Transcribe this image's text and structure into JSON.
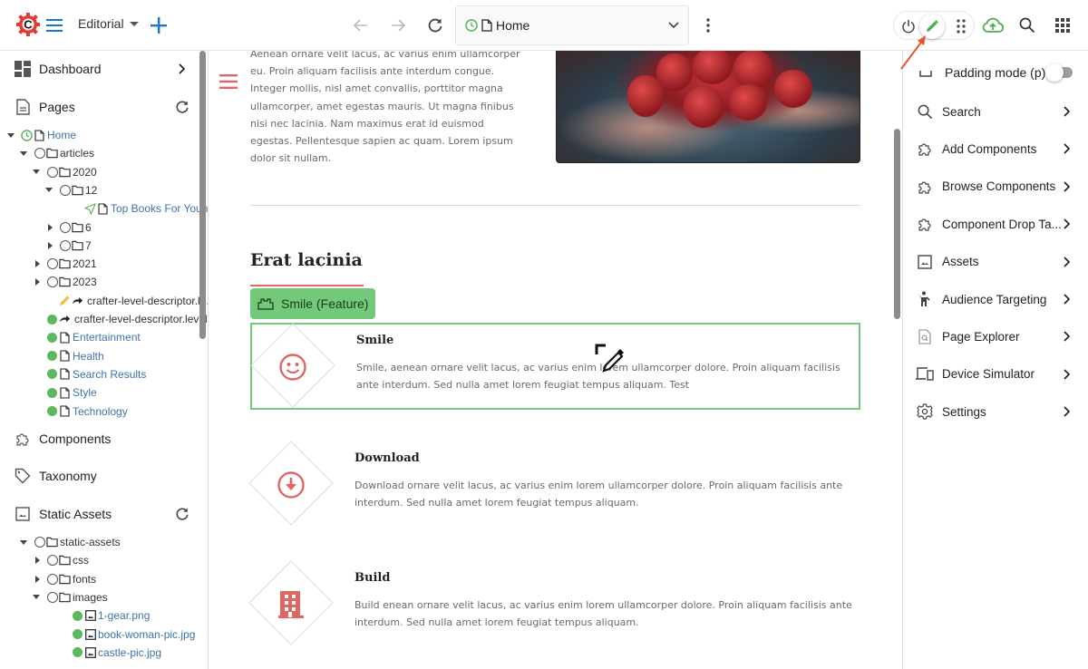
{
  "topbar": {
    "site_name": "Editorial",
    "address": {
      "page": "Home"
    },
    "colors": {
      "brand_red": "#e53935",
      "accent_blue": "#1976d2",
      "green": "#4caf50"
    }
  },
  "left_sidebar": {
    "sections": {
      "dashboard": "Dashboard",
      "pages": "Pages",
      "components": "Components",
      "taxonomy": "Taxonomy",
      "static_assets": "Static Assets"
    },
    "pages_tree": [
      {
        "label": "Home",
        "status": "scheduled",
        "icon": "page",
        "expand": "open"
      },
      {
        "label": "articles",
        "status": "none",
        "icon": "folder",
        "expand": "open"
      },
      {
        "label": "2020",
        "status": "none",
        "icon": "folder",
        "expand": "open"
      },
      {
        "label": "12",
        "status": "none",
        "icon": "folder",
        "expand": "open"
      },
      {
        "label": "Top Books For Youn...",
        "status": "submitted",
        "icon": "page",
        "expand": ""
      },
      {
        "label": "6",
        "status": "none",
        "icon": "folder",
        "expand": "closed"
      },
      {
        "label": "7",
        "status": "none",
        "icon": "folder",
        "expand": "closed"
      },
      {
        "label": "2021",
        "status": "none",
        "icon": "folder",
        "expand": "closed"
      },
      {
        "label": "2023",
        "status": "none",
        "icon": "folder",
        "expand": "closed"
      },
      {
        "label": "crafter-level-descriptor.le...",
        "status": "edited",
        "icon": "level-descriptor",
        "expand": ""
      },
      {
        "label": "crafter-level-descriptor.level...",
        "status": "live",
        "icon": "level-descriptor",
        "expand": ""
      },
      {
        "label": "Entertainment",
        "status": "live",
        "icon": "page",
        "expand": ""
      },
      {
        "label": "Health",
        "status": "live",
        "icon": "page",
        "expand": ""
      },
      {
        "label": "Search Results",
        "status": "live",
        "icon": "page",
        "expand": ""
      },
      {
        "label": "Style",
        "status": "live",
        "icon": "page",
        "expand": ""
      },
      {
        "label": "Technology",
        "status": "live",
        "icon": "page",
        "expand": ""
      }
    ],
    "assets_tree": [
      {
        "label": "static-assets",
        "status": "none",
        "icon": "folder",
        "expand": "open"
      },
      {
        "label": "css",
        "status": "none",
        "icon": "folder",
        "expand": "closed"
      },
      {
        "label": "fonts",
        "status": "none",
        "icon": "folder",
        "expand": "closed"
      },
      {
        "label": "images",
        "status": "none",
        "icon": "folder",
        "expand": "open"
      },
      {
        "label": "1-gear.png",
        "status": "live",
        "icon": "image",
        "expand": ""
      },
      {
        "label": "book-woman-pic.jpg",
        "status": "live",
        "icon": "image",
        "expand": ""
      },
      {
        "label": "castle-pic.jpg",
        "status": "live",
        "icon": "image",
        "expand": ""
      }
    ]
  },
  "preview": {
    "intro_paragraph": "Aenean ornare velit lacus, ac varius enim ullamcorper eu. Proin aliquam facilisis ante interdum congue. Integer mollis, nisl amet convallis, porttitor magna ullamcorper, amet egestas mauris. Ut magna finibus nisi nec lacinia. Nam maximus erat id euismod egestas. Pellentesque sapien ac quam. Lorem ipsum dolor sit nullam.",
    "image_alt": "strawberries in hands",
    "section_heading": "Erat lacinia",
    "component_badge": "Smile (Feature)",
    "features": [
      {
        "title": "Smile",
        "icon": "smile",
        "description": "Smile, aenean ornare velit lacus, ac varius enim lorem ullamcorper dolore. Proin aliquam facilisis ante interdum. Sed nulla amet lorem feugiat tempus aliquam. Test"
      },
      {
        "title": "Download",
        "icon": "download",
        "description": "Download ornare velit lacus, ac varius enim lorem ullamcorper dolore. Proin aliquam facilisis ante interdum. Sed nulla amet lorem feugiat tempus aliquam."
      },
      {
        "title": "Build",
        "icon": "building",
        "description": "Build enean ornare velit lacus, ac varius enim lorem ullamcorper dolore. Proin aliquam facilisis ante interdum. Sed nulla amet lorem feugiat tempus aliquam."
      }
    ]
  },
  "right_panel": {
    "padding_mode": {
      "label": "Padding mode (p)",
      "enabled": false
    },
    "items": [
      {
        "label": "Search",
        "icon": "search"
      },
      {
        "label": "Add Components",
        "icon": "puzzle"
      },
      {
        "label": "Browse Components",
        "icon": "puzzle"
      },
      {
        "label": "Component Drop Ta...",
        "icon": "puzzle"
      },
      {
        "label": "Assets",
        "icon": "image"
      },
      {
        "label": "Audience Targeting",
        "icon": "person"
      },
      {
        "label": "Page Explorer",
        "icon": "page-search"
      },
      {
        "label": "Device Simulator",
        "icon": "devices"
      },
      {
        "label": "Settings",
        "icon": "gear"
      }
    ]
  }
}
